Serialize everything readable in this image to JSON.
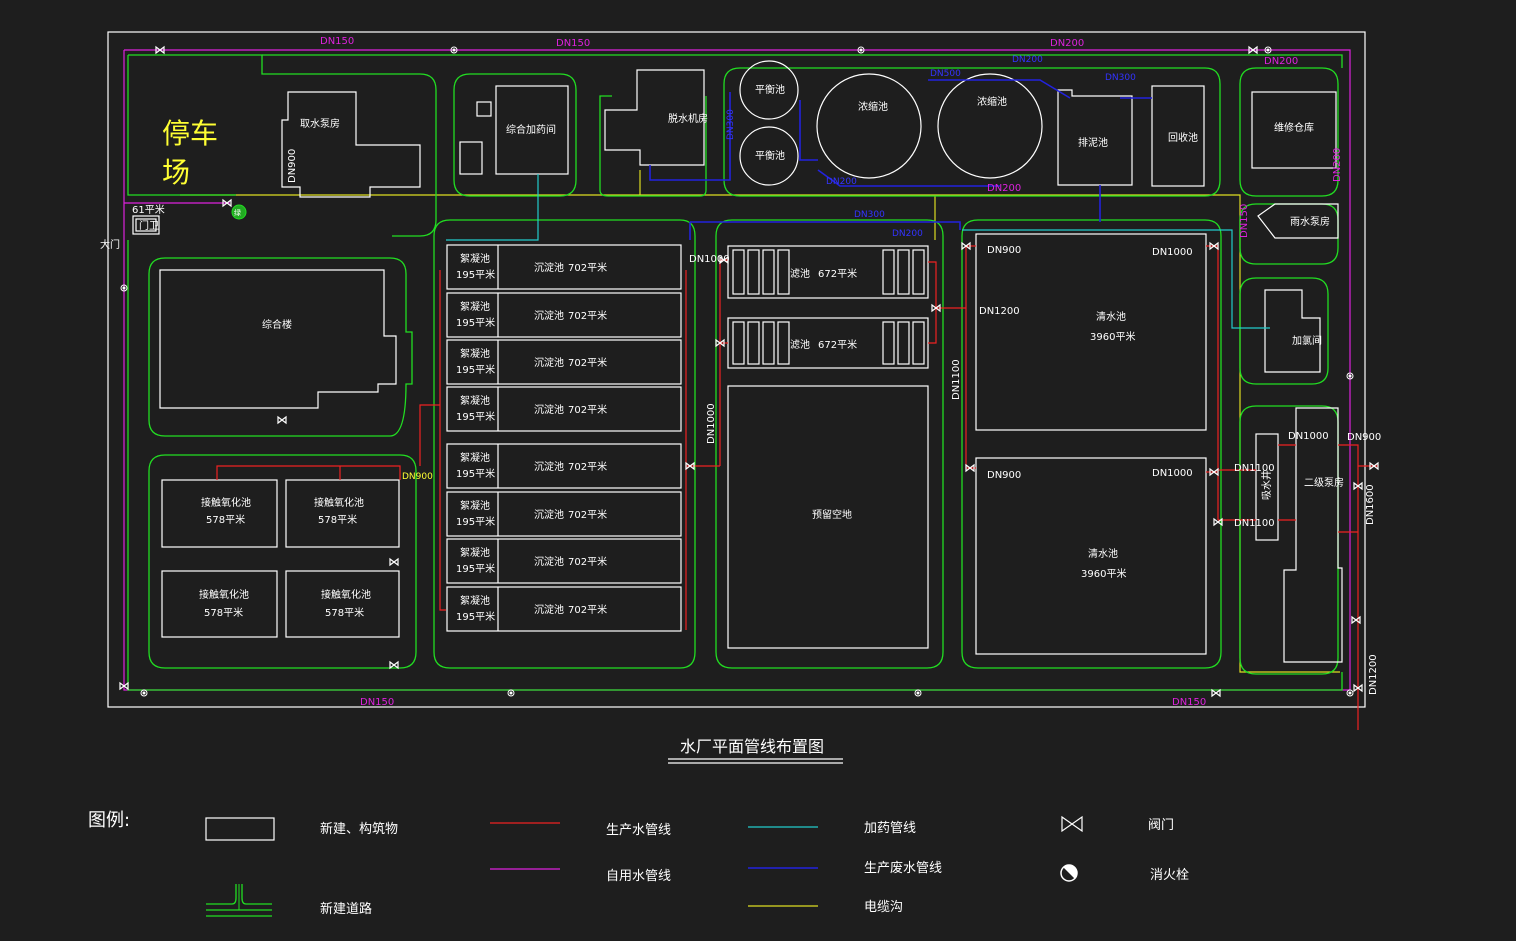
{
  "title": "水厂平面管线布置图",
  "parking": [
    "停车",
    "场"
  ],
  "gate": {
    "main": "大门",
    "guard": "门卫",
    "guard_area": "61平米"
  },
  "green_badge": "绿",
  "buildings": {
    "intake_pump": "取水泵房",
    "dosing": "综合加药间",
    "sludge_room": "脱水机房",
    "balance1": "平衡池",
    "balance2": "平衡池",
    "thickener1": "浓缩池",
    "thickener2": "浓缩池",
    "sludge_pool": "排泥池",
    "recovery": "回收池",
    "repair": "维修仓库",
    "rain_pump": "雨水泵房",
    "chlorine": "加氯间",
    "office": "综合楼",
    "reserve": "预留空地",
    "suction_well": "吸水井",
    "second_pump": "二级泵房"
  },
  "clearwells": [
    {
      "name": "清水池",
      "area": "3960平米"
    },
    {
      "name": "清水池",
      "area": "3960平米"
    }
  ],
  "filters": [
    {
      "name": "滤池",
      "area": "672平米"
    },
    {
      "name": "滤池",
      "area": "672平米"
    }
  ],
  "oxidation": [
    {
      "name": "接触氧化池",
      "area": "578平米"
    },
    {
      "name": "接触氧化池",
      "area": "578平米"
    },
    {
      "name": "接触氧化池",
      "area": "578平米"
    },
    {
      "name": "接触氧化池",
      "area": "578平米"
    }
  ],
  "floc_sed": [
    {
      "floc": "絮凝池",
      "floc_area": "195平米",
      "sed": "沉淀池",
      "sed_area": "702平米"
    },
    {
      "floc": "絮凝池",
      "floc_area": "195平米",
      "sed": "沉淀池",
      "sed_area": "702平米"
    },
    {
      "floc": "絮凝池",
      "floc_area": "195平米",
      "sed": "沉淀池",
      "sed_area": "702平米"
    },
    {
      "floc": "絮凝池",
      "floc_area": "195平米",
      "sed": "沉淀池",
      "sed_area": "702平米"
    },
    {
      "floc": "絮凝池",
      "floc_area": "195平米",
      "sed": "沉淀池",
      "sed_area": "702平米"
    },
    {
      "floc": "絮凝池",
      "floc_area": "195平米",
      "sed": "沉淀池",
      "sed_area": "702平米"
    },
    {
      "floc": "絮凝池",
      "floc_area": "195平米",
      "sed": "沉淀池",
      "sed_area": "702平米"
    },
    {
      "floc": "絮凝池",
      "floc_area": "195平米",
      "sed": "沉淀池",
      "sed_area": "702平米"
    }
  ],
  "pipe_labels": {
    "top1": "DN150",
    "top2": "DN150",
    "top3": "DN200",
    "top4": "DN200",
    "bottom1": "DN150",
    "bottom2": "DN150",
    "intake": "DN900",
    "right_dn200": "DN200",
    "rain_dn150": "DN150",
    "thickener_dn200": "DN200",
    "filter_in": "DN1000",
    "filter_mid": "DN1000",
    "cw_in": "DN1100",
    "cw1_tl": "DN900",
    "cw1_tr": "DN1000",
    "cw1_l": "DN1200",
    "cw2_tl": "DN900",
    "cw2_tr": "DN1000",
    "sw_1": "DN1000",
    "sw_2": "DN1100",
    "sw_3": "DN1100",
    "out_dn900": "DN900",
    "out_dn1600": "DN1600",
    "out_dn1200": "DN1200",
    "ox_in": "DN900",
    "blue1": "DN500",
    "blue2": "DN200",
    "blue3": "DN300",
    "blue4": "DN200",
    "blue5": "DN300",
    "blue6": "DN200",
    "blue7": "DN300"
  },
  "legend": {
    "heading": "图例:",
    "items": [
      {
        "label": "新建、构筑物",
        "symbol": "rect"
      },
      {
        "label": "生产水管线",
        "symbol": "line",
        "color": "#ee2222"
      },
      {
        "label": "加药管线",
        "symbol": "line",
        "color": "#22cccc"
      },
      {
        "label": "阀门",
        "symbol": "valve"
      },
      {
        "label": "新建道路",
        "symbol": "road",
        "color": "#22dd22"
      },
      {
        "label": "自用水管线",
        "symbol": "line",
        "color": "#dd22dd"
      },
      {
        "label": "生产废水管线",
        "symbol": "line",
        "color": "#2222dd"
      },
      {
        "label": "消火栓",
        "symbol": "hydrant"
      },
      {
        "label": "电缆沟",
        "symbol": "line",
        "color": "#dddd22"
      }
    ]
  },
  "colors": {
    "background": "#1e1e1e",
    "structure": "#ffffff",
    "road": "#22dd22",
    "production_water": "#ee2222",
    "self_use_water": "#dd22dd",
    "dosing": "#22cccc",
    "waste_water": "#2222dd",
    "cable": "#dddd22",
    "parking_text": "#ffff33"
  }
}
